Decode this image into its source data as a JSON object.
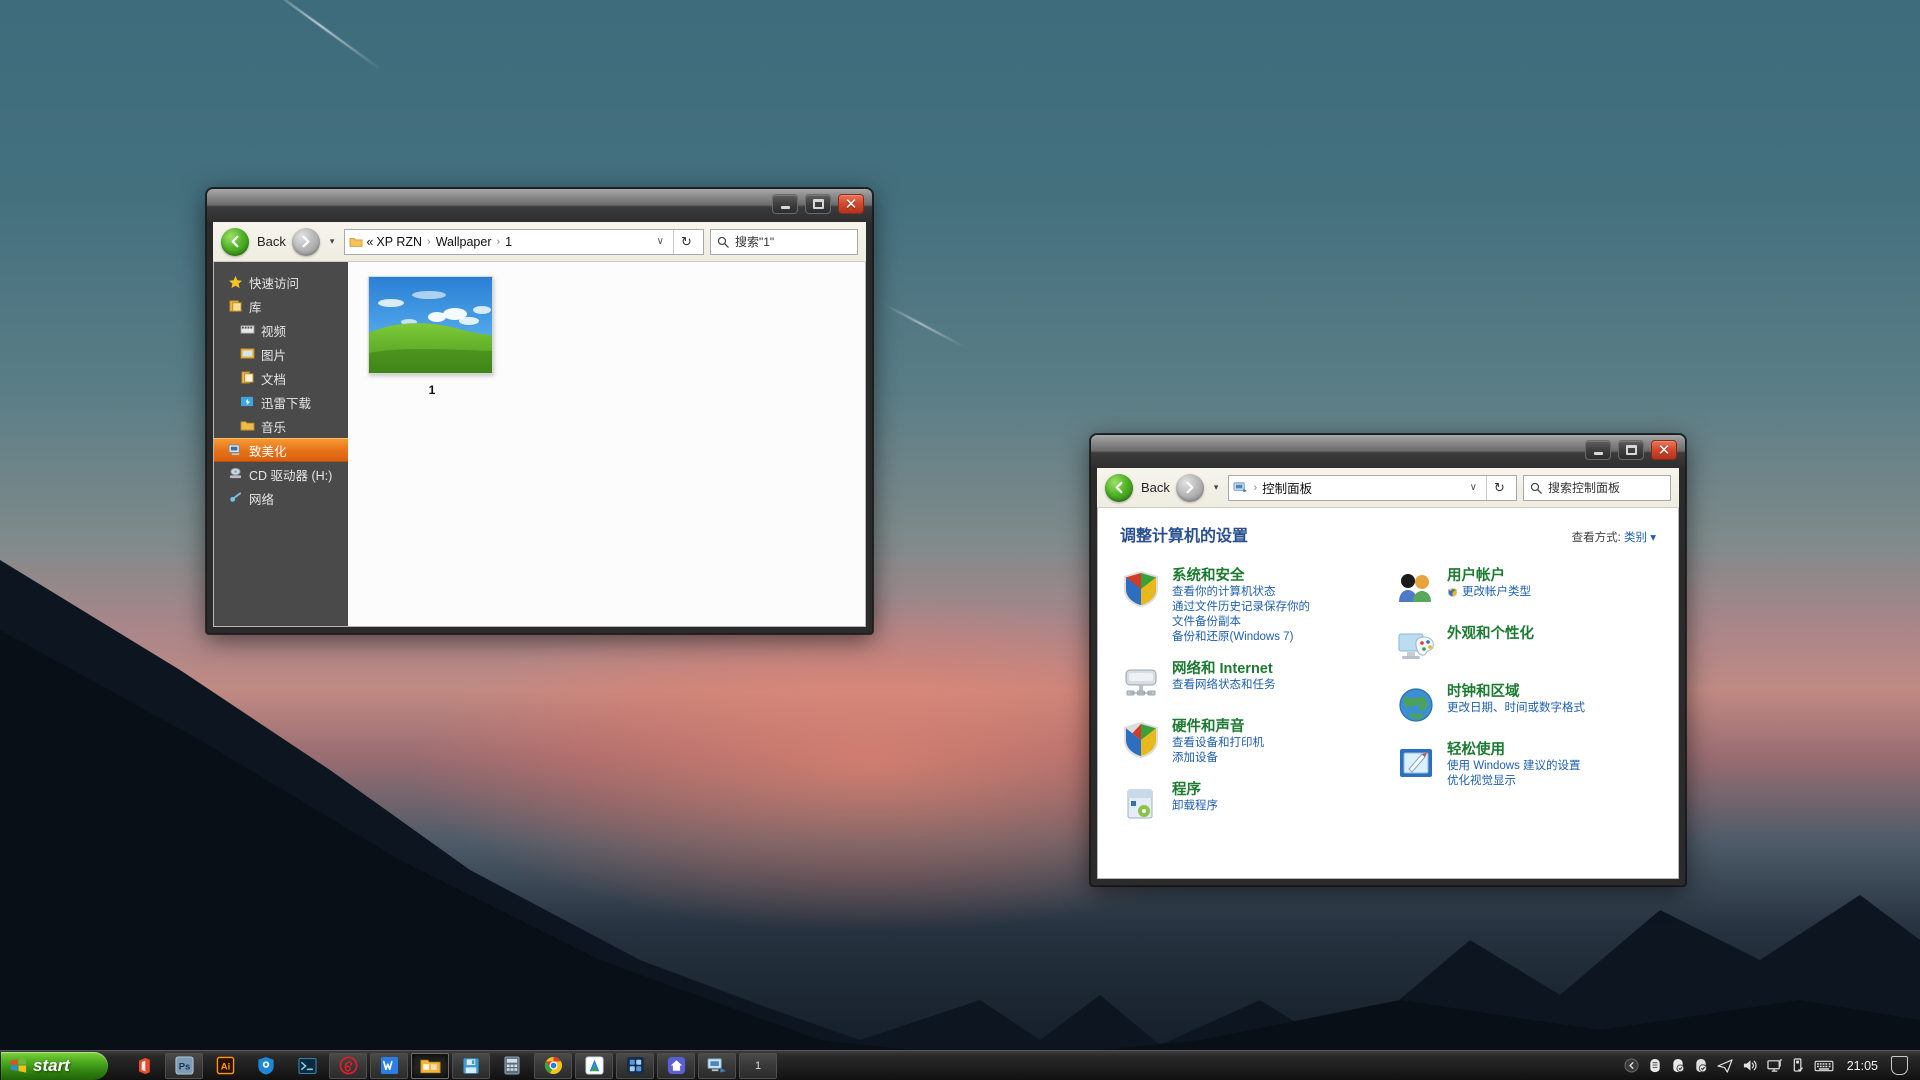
{
  "desktop": {
    "wallpaper_description": "mountain-sunset-wallpaper",
    "sky_color": "#3e6c7c",
    "glow_color": "#ff8c6e",
    "mountain_color": "#101a24"
  },
  "explorer": {
    "window_name": "file-explorer",
    "titlebar": {
      "minimize_label": "–",
      "maximize_label": "□",
      "close_label": "✕"
    },
    "toolbar": {
      "back_label": "Back",
      "back_icon": "back-arrow-icon",
      "forward_icon": "forward-arrow-icon",
      "history_caret": "▾",
      "folder_icon": "folder-icon",
      "breadcrumb_prefix": "«",
      "breadcrumbs": [
        "XP RZN",
        "Wallpaper",
        "1"
      ],
      "breadcrumb_separator": "›",
      "address_dropdown": "∨",
      "refresh_icon": "↻",
      "search_icon": "search-icon",
      "search_value": "搜索\"1\"",
      "search_placeholder": "搜索\"1\""
    },
    "sidebar": {
      "items": [
        {
          "label": "快速访问",
          "icon": "star-icon",
          "indent": false,
          "selected": false
        },
        {
          "label": "库",
          "icon": "library-icon",
          "indent": false,
          "selected": false
        },
        {
          "label": "视频",
          "icon": "video-icon",
          "indent": true,
          "selected": false
        },
        {
          "label": "图片",
          "icon": "pictures-icon",
          "indent": true,
          "selected": false
        },
        {
          "label": "文档",
          "icon": "documents-icon",
          "indent": true,
          "selected": false
        },
        {
          "label": "迅雷下载",
          "icon": "thunder-download-icon",
          "indent": true,
          "selected": false
        },
        {
          "label": "音乐",
          "icon": "music-folder-icon",
          "indent": true,
          "selected": false
        },
        {
          "label": "致美化",
          "icon": "computer-icon",
          "indent": false,
          "selected": true
        },
        {
          "label": "CD 驱动器 (H:)",
          "icon": "cd-drive-icon",
          "indent": false,
          "selected": false
        },
        {
          "label": "网络",
          "icon": "network-icon",
          "indent": false,
          "selected": false
        }
      ],
      "selected_color": "#e8741a",
      "background_color": "#4a4a4a"
    },
    "files": [
      {
        "name": "1",
        "thumbnail": "windows-xp-bliss-wallpaper"
      }
    ]
  },
  "control_panel": {
    "window_name": "control-panel",
    "titlebar": {
      "minimize_label": "–",
      "maximize_label": "□",
      "close_label": "✕"
    },
    "toolbar": {
      "back_label": "Back",
      "history_caret": "▾",
      "cpanel_icon": "control-panel-icon",
      "breadcrumb_separator": "›",
      "breadcrumbs": [
        "控制面板"
      ],
      "address_dropdown": "∨",
      "refresh_icon": "↻",
      "search_icon": "search-icon",
      "search_placeholder": "搜索控制面板",
      "search_value": "搜索控制面板"
    },
    "page_title": "调整计算机的设置",
    "view_by_label": "查看方式:",
    "view_by_value": "类别",
    "view_by_caret": "▾",
    "categories_left": [
      {
        "name": "系统和安全",
        "icon": "security-shield-icon",
        "links": [
          "查看你的计算机状态",
          "通过文件历史记录保存你的",
          "文件备份副本",
          "备份和还原(Windows 7)"
        ]
      },
      {
        "name": "网络和 Internet",
        "icon": "network-computer-icon",
        "links": [
          "查看网络状态和任务"
        ]
      },
      {
        "name": "硬件和声音",
        "icon": "hardware-shield-icon",
        "links": [
          "查看设备和打印机",
          "添加设备"
        ]
      },
      {
        "name": "程序",
        "icon": "programs-icon",
        "links": [
          "卸载程序"
        ]
      }
    ],
    "categories_right": [
      {
        "name": "用户帐户",
        "icon": "user-accounts-icon",
        "links": [
          "更改帐户类型"
        ],
        "link_icon": "shield-badge-icon"
      },
      {
        "name": "外观和个性化",
        "icon": "appearance-palette-icon",
        "links": []
      },
      {
        "name": "时钟和区域",
        "icon": "clock-region-globe-icon",
        "links": [
          "更改日期、时间或数字格式"
        ]
      },
      {
        "name": "轻松使用",
        "icon": "ease-of-access-icon",
        "links": [
          "使用 Windows 建议的设置",
          "优化视觉显示"
        ]
      }
    ],
    "accent_heading_color": "#1d7a32",
    "link_color": "#1f5fae"
  },
  "taskbar": {
    "start_label": "start",
    "start_icon": "windows-flag-icon",
    "items": [
      {
        "icon": "office-icon",
        "style": "plain"
      },
      {
        "icon": "photoshop-icon",
        "style": "normal"
      },
      {
        "icon": "illustrator-icon",
        "style": "plain"
      },
      {
        "icon": "shield-browser-icon",
        "style": "plain"
      },
      {
        "icon": "terminal-icon",
        "style": "plain"
      },
      {
        "icon": "netease-music-icon",
        "style": "normal"
      },
      {
        "icon": "wps-icon",
        "style": "normal"
      },
      {
        "icon": "file-explorer-icon",
        "style": "active"
      },
      {
        "icon": "save-disk-icon",
        "style": "normal"
      },
      {
        "icon": "calculator-icon",
        "style": "plain"
      },
      {
        "icon": "chrome-icon",
        "style": "normal"
      },
      {
        "icon": "letter-a-app-icon",
        "style": "normal"
      },
      {
        "icon": "grid-app-icon",
        "style": "normal"
      },
      {
        "icon": "home-app-icon",
        "style": "normal"
      },
      {
        "icon": "control-panel-icon",
        "style": "normal"
      },
      {
        "icon": "text-item-icon",
        "label": "1",
        "style": "normal"
      }
    ],
    "tray": {
      "expand_icon": "chevron-left-icon",
      "icons": [
        "shield-guard-icon",
        "shield-check-icon",
        "shield-ok-icon",
        "telegram-send-icon",
        "volume-icon",
        "network-display-icon",
        "usb-eject-icon",
        "keyboard-ime-icon"
      ],
      "clock": "21:05",
      "notification_icon": "notification-icon"
    }
  }
}
